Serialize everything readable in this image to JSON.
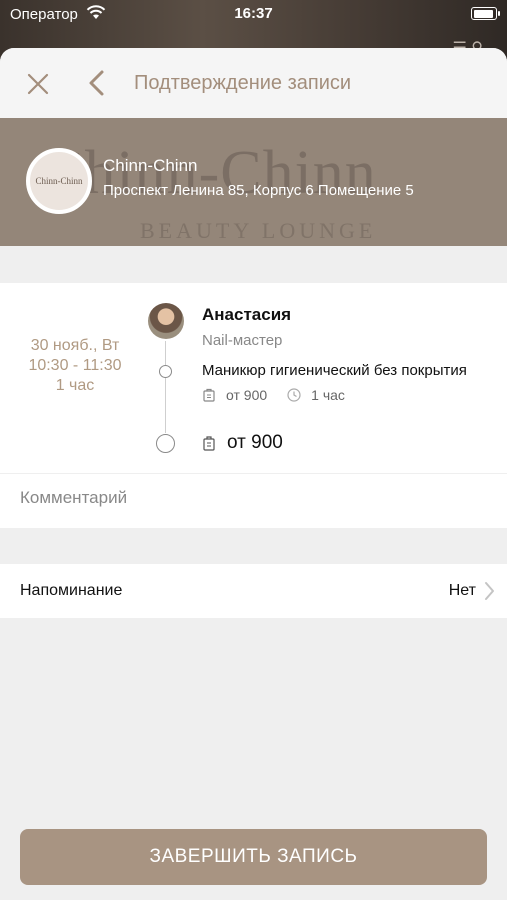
{
  "status_bar": {
    "carrier": "Оператор",
    "time": "16:37"
  },
  "nav": {
    "title": "Подтверждение записи"
  },
  "salon": {
    "name": "Chinn-Chinn",
    "address": "Проспект Ленина 85, Корпус 6 Помещение 5",
    "logo_text": "Chinn-Chinn",
    "watermark": "Chinn-Chinn",
    "watermark_sub": "BEAUTY LOUNGE"
  },
  "booking": {
    "date": "30 нояб., Вт",
    "time": "10:30 - 11:30",
    "duration": "1 час",
    "master_name": "Анастасия",
    "master_role": "Nail-мастер",
    "service": "Маникюр гигиенический без покрытия",
    "price": "от 900",
    "service_duration": "1 час",
    "total": "от 900"
  },
  "comment": {
    "placeholder": "Комментарий"
  },
  "reminder": {
    "label": "Напоминание",
    "value": "Нет"
  },
  "cta": {
    "label": "ЗАВЕРШИТЬ ЗАПИСЬ"
  },
  "colors": {
    "accent": "#a89482",
    "hero": "#948679",
    "date_text": "#b09a83"
  }
}
